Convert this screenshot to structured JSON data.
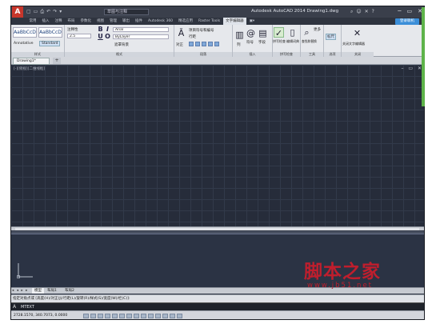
{
  "app": {
    "logo_letter": "A",
    "title": "Autodesk AutoCAD 2014   Drawing1.dwg"
  },
  "quick_access": [
    "▢",
    "▭",
    "⎙",
    "↶",
    "↷",
    "▾"
  ],
  "workspace": {
    "value": "草图与注释"
  },
  "window_controls": [
    "─",
    "▭",
    "✕"
  ],
  "ribbon_tabs": [
    "常用",
    "插入",
    "注释",
    "布局",
    "参数化",
    "视图",
    "管理",
    "输出",
    "插件",
    "Autodesk 360",
    "精选应用",
    "Raster Tools",
    "文字编辑器",
    "▣▾"
  ],
  "active_tab_index": 12,
  "signin": "登录联机",
  "ribbon": {
    "style": {
      "sample1": "AaBbCcD",
      "sample2": "AaBbCcD",
      "annotative": "Annotative",
      "standard": "Standard",
      "label": "样式"
    },
    "format": {
      "annotative_label": "注释性",
      "height": "2.5",
      "bold": "B",
      "italic": "I",
      "font": "Arial",
      "underline": "U",
      "overline": "O",
      "color": "ByLayer",
      "mask": "遮罩背景",
      "label": "格式"
    },
    "paragraph": {
      "justify": "对正",
      "bullets": "项目符号和编号",
      "line_spacing": "行距",
      "label": "段落"
    },
    "insert": {
      "columns": "列",
      "symbol": "符号",
      "field": "字段",
      "label": "插入"
    },
    "spell": {
      "check": "拼写检查",
      "edit_dict": "编辑词典",
      "label": "拼写检查"
    },
    "tools": {
      "find_replace": "查找和替换",
      "more": "更多",
      "ruler": "标尺",
      "label": "工具"
    },
    "options": {
      "label": "选项"
    },
    "close": {
      "text": "关闭文字编辑器",
      "label": "关闭"
    }
  },
  "file_tab": "Drawing1*",
  "viewport_label": "[-][俯视][二维线框]",
  "viewport_controls": "– ▭ ✕",
  "layout_nav": "◂ ◂ ▸ ▸",
  "layout_tabs": [
    "模型",
    "布局1",
    "布局2"
  ],
  "command_history": "指定对角点或 [高度(H)/对正(J)/行距(L)/旋转(R)/样式(S)/宽度(W)/栏(C)]:",
  "command_prompt": "A",
  "command_input": "MTEXT",
  "coords": "2728.1570, 340.7073, 0.0000",
  "watermark": {
    "cn": "脚本之家",
    "url": "www.jb51.net"
  }
}
